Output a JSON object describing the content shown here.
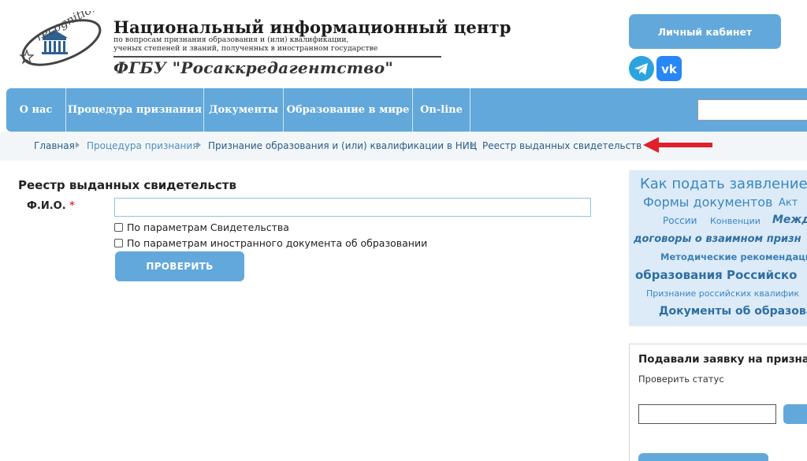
{
  "header": {
    "logo_text": "recognition",
    "title": "Национальный информационный центр",
    "subtitle_lines": [
      "по вопросам признания образования и (или) квалификации,",
      "ученых степеней и званий, полученных в иностранном государстве"
    ],
    "org": "ФГБУ \"Росаккредагентство\"",
    "cabinet_label": "Личный кабинет",
    "social_icons": [
      "telegram-icon",
      "vk-icon"
    ]
  },
  "nav": {
    "items": [
      {
        "label": "О нас"
      },
      {
        "label": "Процедура признания"
      },
      {
        "label": "Документы"
      },
      {
        "label": "Образование в мире"
      },
      {
        "label": "On-line"
      }
    ],
    "search_value": ""
  },
  "breadcrumb": {
    "items": [
      "Главная",
      "Процедура признания",
      "Признание образования и (или) квалификации в НИЦ",
      "Реестр выданных свидетельств"
    ]
  },
  "form": {
    "page_title": "Реестр выданных свидетельств",
    "fio_label": "Ф.И.О.",
    "required_mark": "*",
    "fio_value": "",
    "checkboxes": [
      {
        "label": "По параметрам Свидетельства",
        "checked": false
      },
      {
        "label": "По параметрам иностранного документа об образовании",
        "checked": false
      }
    ],
    "submit_label": "ПРОВЕРИТЬ"
  },
  "tag_cloud": [
    "Как подать заявление о",
    "Формы документов",
    "Акт",
    "России",
    "Конвенции",
    "Межд",
    "договоры о взаимном призн",
    "Методические рекомендаци",
    "образования Российско",
    "Признание российских квалифик",
    "Документы об образова"
  ],
  "side_box": {
    "title": "Подавали заявку на призна",
    "subtitle": "Проверить статус",
    "input_value": ""
  },
  "colors": {
    "accent": "#62a8db",
    "nav_bg": "#62a8db",
    "tag_bg": "#dcebf7",
    "arrow": "#e0202a",
    "required": "#e03a3a"
  }
}
